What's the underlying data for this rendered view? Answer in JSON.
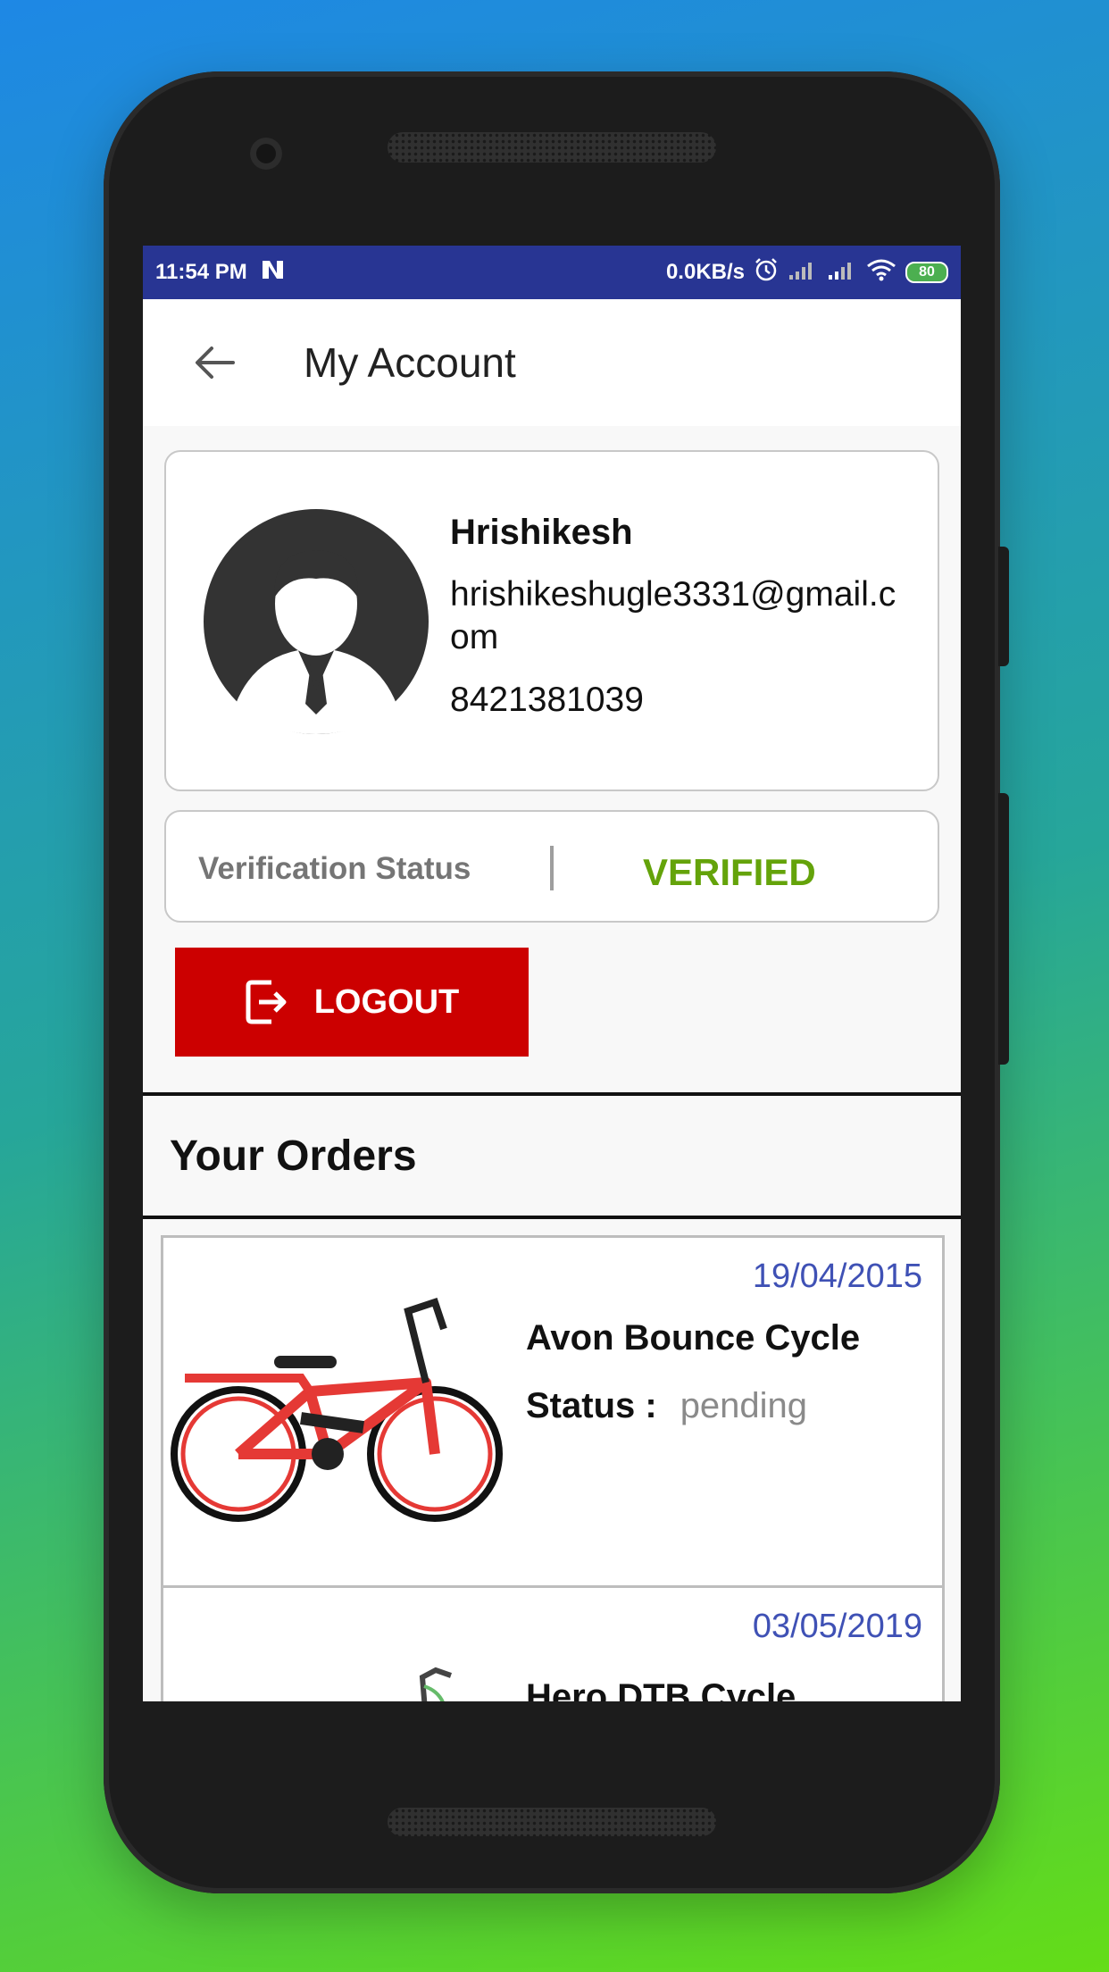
{
  "status_bar": {
    "time": "11:54 PM",
    "network_speed": "0.0KB/s",
    "battery": "80"
  },
  "appbar": {
    "title": "My Account"
  },
  "profile": {
    "name": "Hrishikesh",
    "email": "hrishikeshugle3331@gmail.com",
    "phone": "8421381039"
  },
  "verification": {
    "label": "Verification Status",
    "value": "VERIFIED",
    "value_color": "#64a30a"
  },
  "logout": {
    "label": "LOGOUT",
    "color": "#cc0000"
  },
  "orders": {
    "title": "Your Orders",
    "status_label": "Status :",
    "items": [
      {
        "date": "19/04/2015",
        "name": "Avon Bounce Cycle",
        "status": "pending"
      },
      {
        "date": "03/05/2019",
        "name": "Hero DTB Cycle"
      }
    ]
  },
  "colors": {
    "status_bar": "#283593",
    "date_text": "#3f51b5"
  }
}
